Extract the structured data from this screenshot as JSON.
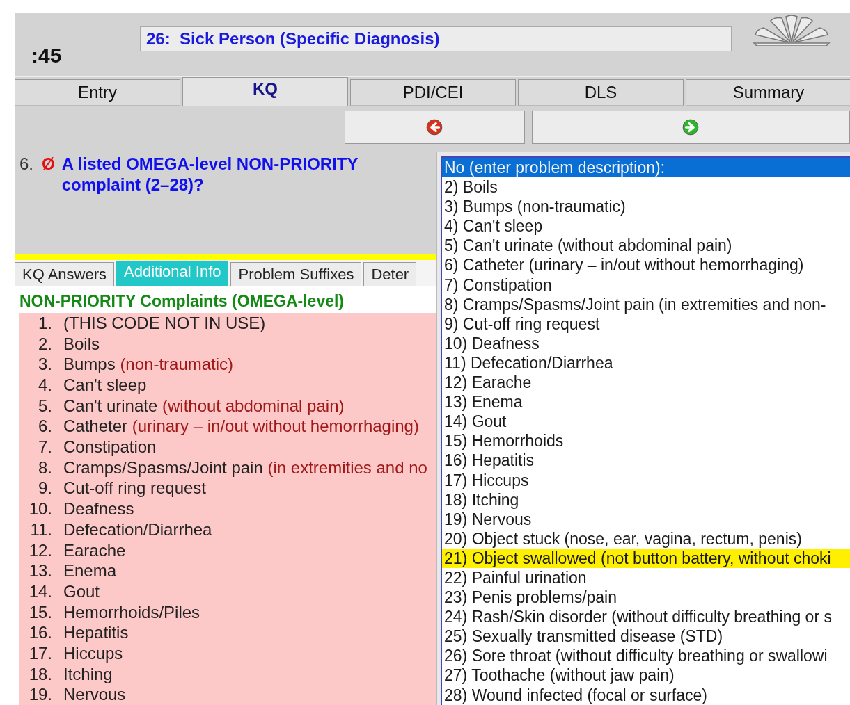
{
  "header": {
    "timer": ":45",
    "title": "26:  Sick Person (Specific Diagnosis)"
  },
  "tabs": [
    {
      "label": "Entry",
      "selected": false
    },
    {
      "label": "KQ",
      "selected": true
    },
    {
      "label": "PDI/CEI",
      "selected": false
    },
    {
      "label": "DLS",
      "selected": false
    },
    {
      "label": "Summary",
      "selected": false
    }
  ],
  "nav": [
    {
      "kind": "back"
    },
    {
      "kind": "forward"
    }
  ],
  "question": {
    "number": "6.",
    "mark": "Ø",
    "text": "A listed OMEGA-level NON-PRIORITY complaint (2–28)?"
  },
  "subtabs": [
    {
      "label": "KQ Answers",
      "selected": false
    },
    {
      "label": "Additional Info",
      "selected": true
    },
    {
      "label": "Problem Suffixes",
      "selected": false
    },
    {
      "label": "Deter",
      "selected": false
    }
  ],
  "info": {
    "heading": "NON-PRIORITY Complaints (OMEGA-level)",
    "items": [
      {
        "number": "1.",
        "name": "(THIS CODE NOT IN USE)"
      },
      {
        "number": "2.",
        "name": "Boils"
      },
      {
        "number": "3.",
        "name": "Bumps",
        "detail": "(non-traumatic)"
      },
      {
        "number": "4.",
        "name": "Can't sleep"
      },
      {
        "number": "5.",
        "name": "Can't urinate",
        "detail": "(without abdominal pain)"
      },
      {
        "number": "6.",
        "name": "Catheter",
        "detail": "(urinary – in/out without hemorrhaging)"
      },
      {
        "number": "7.",
        "name": "Constipation"
      },
      {
        "number": "8.",
        "name": "Cramps/Spasms/Joint pain",
        "detail": "(in extremities and no"
      },
      {
        "number": "9.",
        "name": "Cut-off ring request"
      },
      {
        "number": "10.",
        "name": "Deafness"
      },
      {
        "number": "11.",
        "name": "Defecation/Diarrhea"
      },
      {
        "number": "12.",
        "name": "Earache"
      },
      {
        "number": "13.",
        "name": "Enema"
      },
      {
        "number": "14.",
        "name": "Gout"
      },
      {
        "number": "15.",
        "name": "Hemorrhoids/Piles"
      },
      {
        "number": "16.",
        "name": "Hepatitis"
      },
      {
        "number": "17.",
        "name": "Hiccups"
      },
      {
        "number": "18.",
        "name": "Itching"
      },
      {
        "number": "19.",
        "name": "Nervous"
      }
    ]
  },
  "dropdown": {
    "options": [
      {
        "label": "No (enter problem description):",
        "selected": true,
        "highlighted": false
      },
      {
        "label": "2) Boils",
        "selected": false,
        "highlighted": false
      },
      {
        "label": "3) Bumps (non-traumatic)",
        "selected": false,
        "highlighted": false
      },
      {
        "label": "4) Can't sleep",
        "selected": false,
        "highlighted": false
      },
      {
        "label": "5) Can't urinate (without abdominal pain)",
        "selected": false,
        "highlighted": false
      },
      {
        "label": "6) Catheter (urinary – in/out without hemorrhaging)",
        "selected": false,
        "highlighted": false
      },
      {
        "label": "7) Constipation",
        "selected": false,
        "highlighted": false
      },
      {
        "label": "8) Cramps/Spasms/Joint pain (in extremities and non-",
        "selected": false,
        "highlighted": false
      },
      {
        "label": "9) Cut-off ring request",
        "selected": false,
        "highlighted": false
      },
      {
        "label": "10) Deafness",
        "selected": false,
        "highlighted": false
      },
      {
        "label": "11) Defecation/Diarrhea",
        "selected": false,
        "highlighted": false
      },
      {
        "label": "12) Earache",
        "selected": false,
        "highlighted": false
      },
      {
        "label": "13) Enema",
        "selected": false,
        "highlighted": false
      },
      {
        "label": "14) Gout",
        "selected": false,
        "highlighted": false
      },
      {
        "label": "15) Hemorrhoids",
        "selected": false,
        "highlighted": false
      },
      {
        "label": "16) Hepatitis",
        "selected": false,
        "highlighted": false
      },
      {
        "label": "17) Hiccups",
        "selected": false,
        "highlighted": false
      },
      {
        "label": "18) Itching",
        "selected": false,
        "highlighted": false
      },
      {
        "label": "19) Nervous",
        "selected": false,
        "highlighted": false
      },
      {
        "label": "20) Object stuck (nose, ear, vagina, rectum, penis)",
        "selected": false,
        "highlighted": false
      },
      {
        "label": "21) Object swallowed (not button battery, without choki",
        "selected": false,
        "highlighted": true
      },
      {
        "label": "22) Painful urination",
        "selected": false,
        "highlighted": false
      },
      {
        "label": "23) Penis problems/pain",
        "selected": false,
        "highlighted": false
      },
      {
        "label": "24) Rash/Skin disorder (without difficulty breathing or s",
        "selected": false,
        "highlighted": false
      },
      {
        "label": "25) Sexually transmitted disease (STD)",
        "selected": false,
        "highlighted": false
      },
      {
        "label": "26) Sore throat (without difficulty breathing or swallowi",
        "selected": false,
        "highlighted": false
      },
      {
        "label": "27) Toothache (without jaw pain)",
        "selected": false,
        "highlighted": false
      },
      {
        "label": "28) Wound infected (focal or surface)",
        "selected": false,
        "highlighted": false
      }
    ]
  }
}
